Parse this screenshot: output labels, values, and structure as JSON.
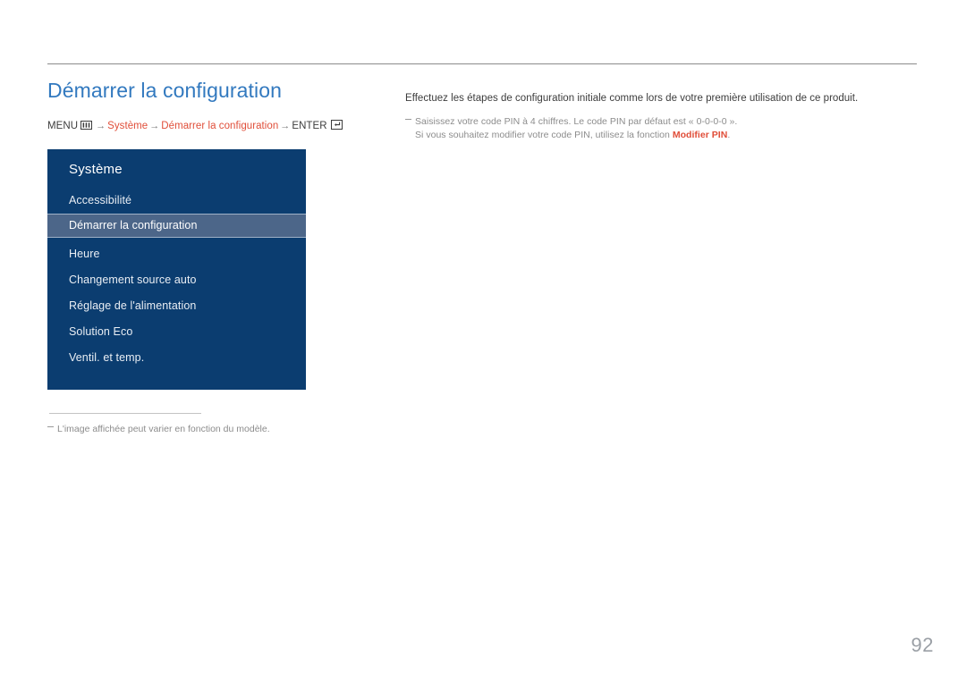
{
  "document": {
    "page_number": "92"
  },
  "header": {
    "title": "Démarrer la configuration"
  },
  "breadcrumb": {
    "menu_label": "MENU",
    "menu_icon": "menu-grid-icon",
    "arrow": "→",
    "step_system": "Système",
    "step_start_setup": "Démarrer la configuration",
    "enter_label": "ENTER",
    "enter_icon": "enter-key-icon"
  },
  "osd_panel": {
    "title": "Système",
    "items": [
      {
        "label": "Accessibilité",
        "selected": false
      },
      {
        "label": "Démarrer la configuration",
        "selected": true
      },
      {
        "label": "Heure",
        "selected": false
      },
      {
        "label": "Changement source auto",
        "selected": false
      },
      {
        "label": "Réglage de l'alimentation",
        "selected": false
      },
      {
        "label": "Solution Eco",
        "selected": false
      },
      {
        "label": "Ventil. et temp.",
        "selected": false
      }
    ]
  },
  "panel_footnote": {
    "text": "L'image affichée peut varier en fonction du modèle."
  },
  "body": {
    "lead": "Effectuez les étapes de configuration initiale comme lors de votre première utilisation de ce produit.",
    "note_line_1": "Saisissez votre code PIN à 4 chiffres. Le code PIN par défaut est « 0-0-0-0 ».",
    "note_line_2_prefix": "Si vous souhaitez modifier votre code PIN, utilisez la fonction ",
    "note_line_2_link": "Modifier PIN",
    "note_line_2_suffix": "."
  },
  "colors": {
    "title_blue": "#3279bf",
    "panel_navy": "#0b3d70",
    "panel_highlight": "#4c6689",
    "accent_orange": "#e04e39",
    "body_gray": "#3c3c3c",
    "note_gray": "#8c8c8c",
    "rule_gray": "#8b8b8b",
    "page_number_gray": "#9ba0a6"
  }
}
